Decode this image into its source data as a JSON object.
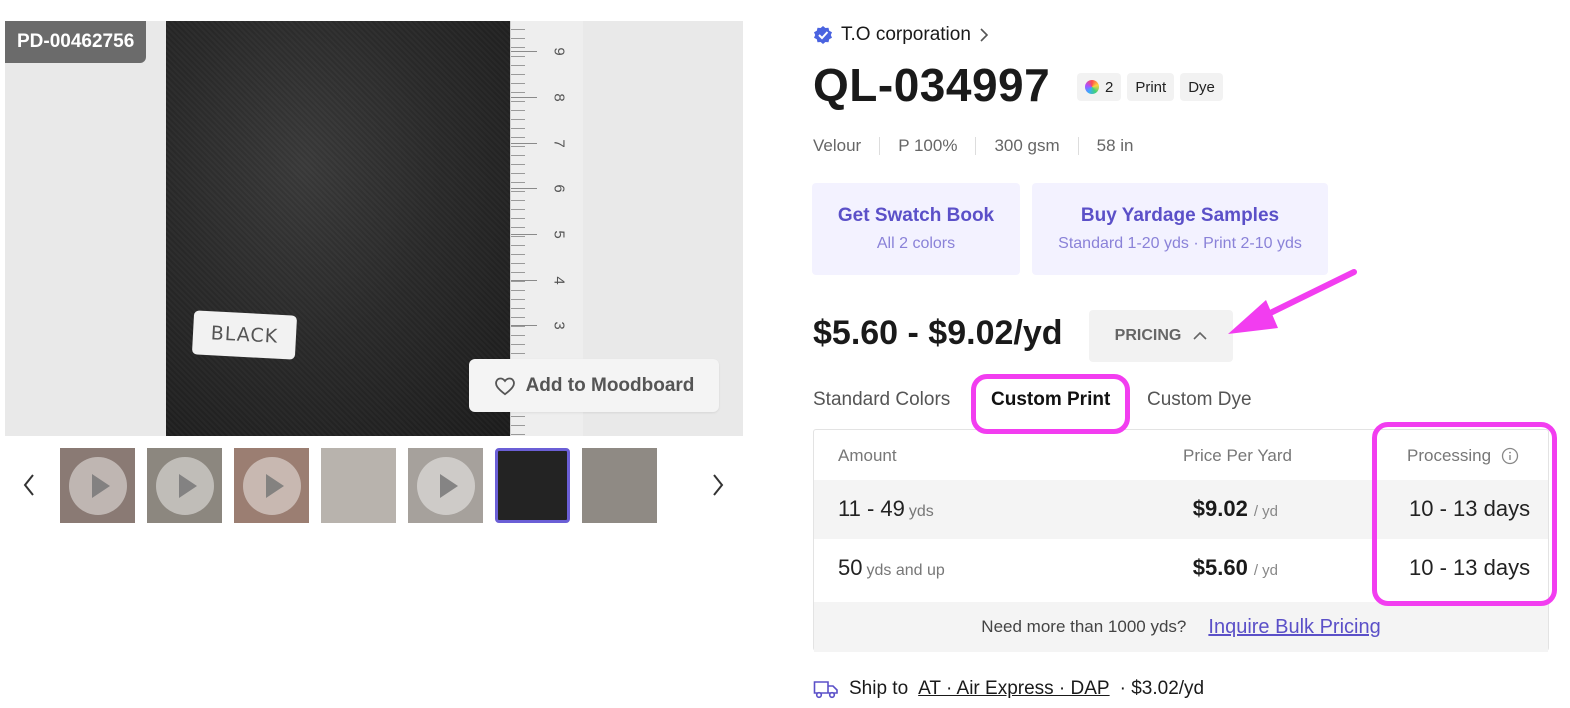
{
  "media": {
    "product_id_badge": "PD-00462756",
    "swatch_label_text": "BLACK",
    "ruler_numbers": [
      "9",
      "8",
      "7",
      "6",
      "5",
      "4",
      "3"
    ],
    "add_to_moodboard_label": "Add to Moodboard",
    "thumbnails": [
      {
        "kind": "video",
        "tone": "#8a7a74"
      },
      {
        "kind": "video",
        "tone": "#8c877f"
      },
      {
        "kind": "video",
        "tone": "#9b7e72"
      },
      {
        "kind": "image",
        "tone": "#b8b3ad"
      },
      {
        "kind": "video",
        "tone": "#a6a19c"
      },
      {
        "kind": "image",
        "tone": "#232323",
        "selected": true
      },
      {
        "kind": "image",
        "tone": "#8f8a84"
      }
    ]
  },
  "supplier": {
    "name": "T.O corporation"
  },
  "product": {
    "code": "QL-034997",
    "tags": [
      {
        "type": "colors",
        "label": "2"
      },
      {
        "type": "text",
        "label": "Print"
      },
      {
        "type": "text",
        "label": "Dye"
      }
    ],
    "specs": [
      "Velour",
      "P 100%",
      "300 gsm",
      "58 in"
    ]
  },
  "actions": {
    "swatch_book": {
      "title": "Get Swatch Book",
      "subtitle": "All 2 colors"
    },
    "yardage_samples": {
      "title": "Buy Yardage Samples",
      "subtitle": "Standard 1-20 yds · Print 2-10 yds"
    }
  },
  "pricing": {
    "range": "$5.60 - $9.02/yd",
    "toggle_label": "PRICING",
    "tabs": [
      "Standard Colors",
      "Custom Print",
      "Custom Dye"
    ],
    "active_tab": "Custom Print",
    "table": {
      "headers": {
        "amount": "Amount",
        "price": "Price Per Yard",
        "processing": "Processing"
      },
      "rows": [
        {
          "amount": "11 - 49",
          "amount_unit": "yds",
          "price": "$9.02",
          "price_unit": "/ yd",
          "processing": "10 - 13 days"
        },
        {
          "amount": "50",
          "amount_unit": "yds and up",
          "price": "$5.60",
          "price_unit": "/ yd",
          "processing": "10 - 13 days"
        }
      ],
      "bulk_question": "Need more than 1000 yds?",
      "bulk_link": "Inquire Bulk Pricing"
    }
  },
  "shipping": {
    "prefix": "Ship to",
    "destination": "AT · Air Express · DAP",
    "suffix": "· $3.02/yd"
  },
  "colors": {
    "accent": "#5b50c8",
    "annotation": "#f23df0",
    "verified": "#4a63e0"
  }
}
